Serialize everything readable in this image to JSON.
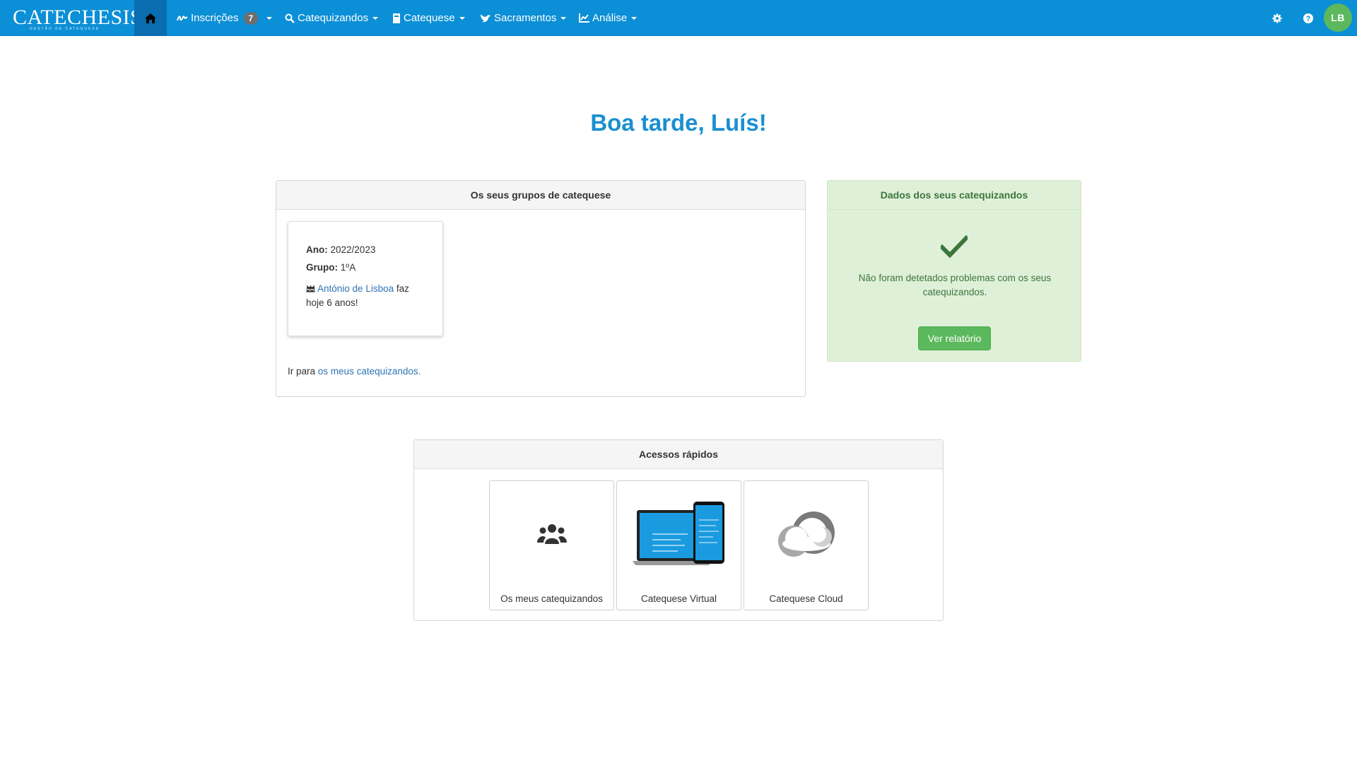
{
  "app": {
    "brand": "CATECHESIS",
    "brand_subtitle": "GESTÃO DE CATEQUESE"
  },
  "nav": {
    "home_icon": "home-icon",
    "items": [
      {
        "label": "Inscrições",
        "icon": "signature-icon",
        "badge": "7"
      },
      {
        "label": "Catequizandos",
        "icon": "search-icon"
      },
      {
        "label": "Catequese",
        "icon": "book-icon"
      },
      {
        "label": "Sacramentos",
        "icon": "dove-icon"
      },
      {
        "label": "Análise",
        "icon": "chart-icon"
      }
    ],
    "right_icons": [
      "gear-icon",
      "help-icon"
    ],
    "avatar_initials": "LB",
    "avatar_color": "#5cb85c"
  },
  "greeting": "Boa tarde, Luís!",
  "groups_panel": {
    "title": "Os seus grupos de catequese",
    "card": {
      "year_label": "Ano:",
      "year_value": "2022/2023",
      "group_label": "Grupo:",
      "group_value": "1ºA",
      "birthday_icon": "birthday-cake-icon",
      "birthday_name": "António de Lisboa",
      "birthday_text_1": "faz",
      "birthday_text_2": "hoje 6 anos!"
    },
    "goto_prefix": "Ir para",
    "goto_link": "os meus catequizandos."
  },
  "data_panel": {
    "title": "Dados dos seus catequizandos",
    "icon": "checkmark-icon",
    "message": "Não foram detetados problemas com os seus catequizandos.",
    "button": "Ver relatório"
  },
  "quick_panel": {
    "title": "Acessos rápidos",
    "tiles": [
      {
        "label": "Os meus catequizandos",
        "icon": "users-icon"
      },
      {
        "label": "Catequese Virtual",
        "icon": "devices-image"
      },
      {
        "label": "Catequese Cloud",
        "icon": "cloud-logo"
      }
    ]
  },
  "colors": {
    "navbar": "#0b8fd6",
    "accent": "#1a8fd1",
    "success": "#5cb85c",
    "success_bg": "#dff0d8"
  }
}
